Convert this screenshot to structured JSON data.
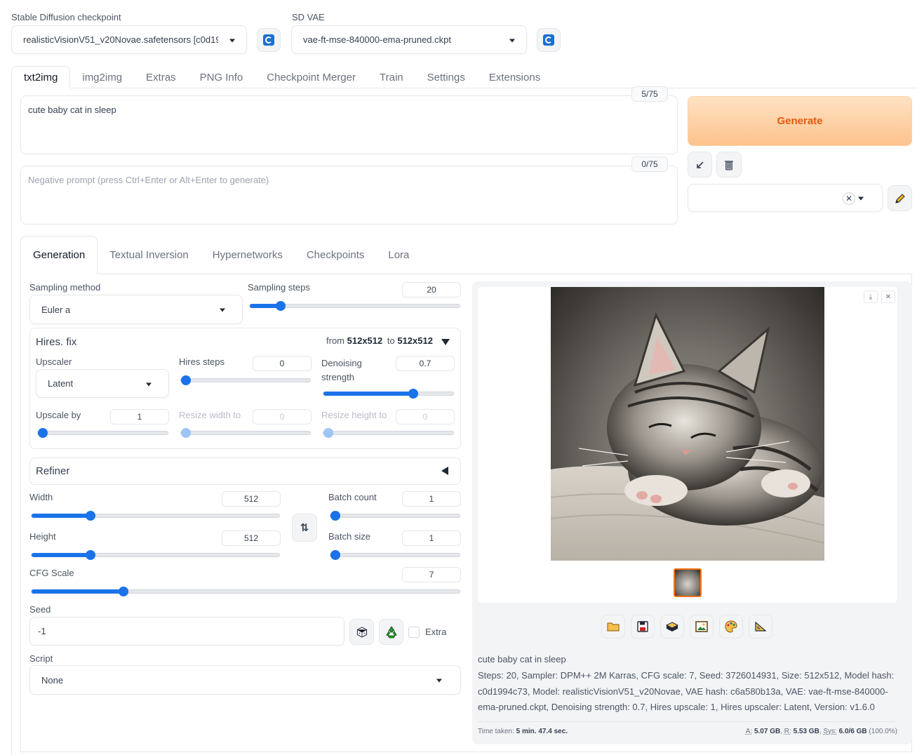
{
  "top": {
    "checkpoint_label": "Stable Diffusion checkpoint",
    "checkpoint_value": "realisticVisionV51_v20Novae.safetensors [c0d19",
    "vae_label": "SD VAE",
    "vae_value": "vae-ft-mse-840000-ema-pruned.ckpt"
  },
  "main_tabs": [
    "txt2img",
    "img2img",
    "Extras",
    "PNG Info",
    "Checkpoint Merger",
    "Train",
    "Settings",
    "Extensions"
  ],
  "prompt": {
    "value": "cute baby cat in sleep",
    "counter": "5/75",
    "negative_placeholder": "Negative prompt (press Ctrl+Enter or Alt+Enter to generate)",
    "negative_counter": "0/75"
  },
  "generate_label": "Generate",
  "sub_tabs": [
    "Generation",
    "Textual Inversion",
    "Hypernetworks",
    "Checkpoints",
    "Lora"
  ],
  "sampling": {
    "method_label": "Sampling method",
    "method_value": "Euler a",
    "steps_label": "Sampling steps",
    "steps_value": "20",
    "steps_fraction": 0.14
  },
  "hires": {
    "title": "Hires. fix",
    "from_text": "from",
    "from_size": "512x512",
    "to_text": "to",
    "to_size": "512x512",
    "upscaler_label": "Upscaler",
    "upscaler_value": "Latent",
    "hires_steps_label": "Hires steps",
    "hires_steps_value": "0",
    "denoising_label": "Denoising strength",
    "denoising_value": "0.7",
    "upscale_by_label": "Upscale by",
    "upscale_by_value": "1",
    "resize_w_label": "Resize width to",
    "resize_w_value": "0",
    "resize_h_label": "Resize height to",
    "resize_h_value": "0"
  },
  "refiner_title": "Refiner",
  "dims": {
    "width_label": "Width",
    "width_value": "512",
    "height_label": "Height",
    "height_value": "512",
    "batch_count_label": "Batch count",
    "batch_count_value": "1",
    "batch_size_label": "Batch size",
    "batch_size_value": "1",
    "cfg_label": "CFG Scale",
    "cfg_value": "7"
  },
  "seed": {
    "label": "Seed",
    "value": "-1",
    "extra_label": "Extra"
  },
  "script": {
    "label": "Script",
    "value": "None"
  },
  "output": {
    "caption": "cute baby cat in sleep",
    "params": "Steps: 20, Sampler: DPM++ 2M Karras, CFG scale: 7, Seed: 3726014931, Size: 512x512, Model hash: c0d1994c73, Model: realisticVisionV51_v20Novae, VAE hash: c6a580b13a, VAE: vae-ft-mse-840000-ema-pruned.ckpt, Denoising strength: 0.7, Hires upscale: 1, Hires upscaler: Latent, Version: v1.6.0",
    "time_label": "Time taken:",
    "time_value": "5 min. 47.4 sec.",
    "mem_a_label": "A:",
    "mem_a_value": "5.07 GB",
    "mem_r_label": "R:",
    "mem_r_value": "5.53 GB",
    "mem_sys_label": "Sys:",
    "mem_sys_value": "6.0/6 GB",
    "mem_pct": "(100.0%)"
  },
  "colors": {
    "accent": "#1a73e8",
    "generate_text": "#ea580c",
    "generate_bg": "#fdba74"
  }
}
